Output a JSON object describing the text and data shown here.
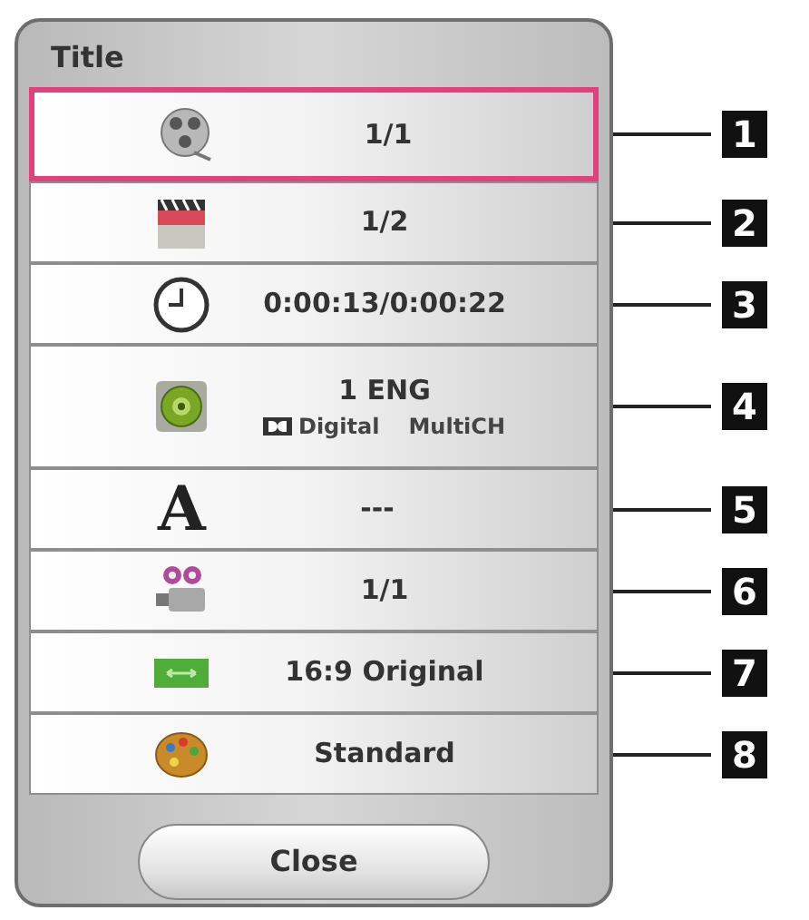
{
  "panel": {
    "title": "Title",
    "rows": [
      {
        "kind": "disc",
        "value": "1/1",
        "selected": true,
        "callout": "1"
      },
      {
        "kind": "clapper",
        "value": "1/2",
        "selected": false,
        "callout": "2"
      },
      {
        "kind": "clock",
        "value": "0:00:13/0:00:22",
        "selected": false,
        "callout": "3"
      },
      {
        "kind": "speaker",
        "value": "1 ENG",
        "sub": [
          "Digital",
          "MultiCH"
        ],
        "selected": false,
        "callout": "4"
      },
      {
        "kind": "subtitle",
        "glyph": "A",
        "value": "---",
        "selected": false,
        "callout": "5"
      },
      {
        "kind": "camera",
        "value": "1/1",
        "selected": false,
        "callout": "6"
      },
      {
        "kind": "aspect",
        "value": "16:9 Original",
        "selected": false,
        "callout": "7"
      },
      {
        "kind": "palette",
        "value": "Standard",
        "selected": false,
        "callout": "8"
      }
    ],
    "close_button": "Close"
  }
}
